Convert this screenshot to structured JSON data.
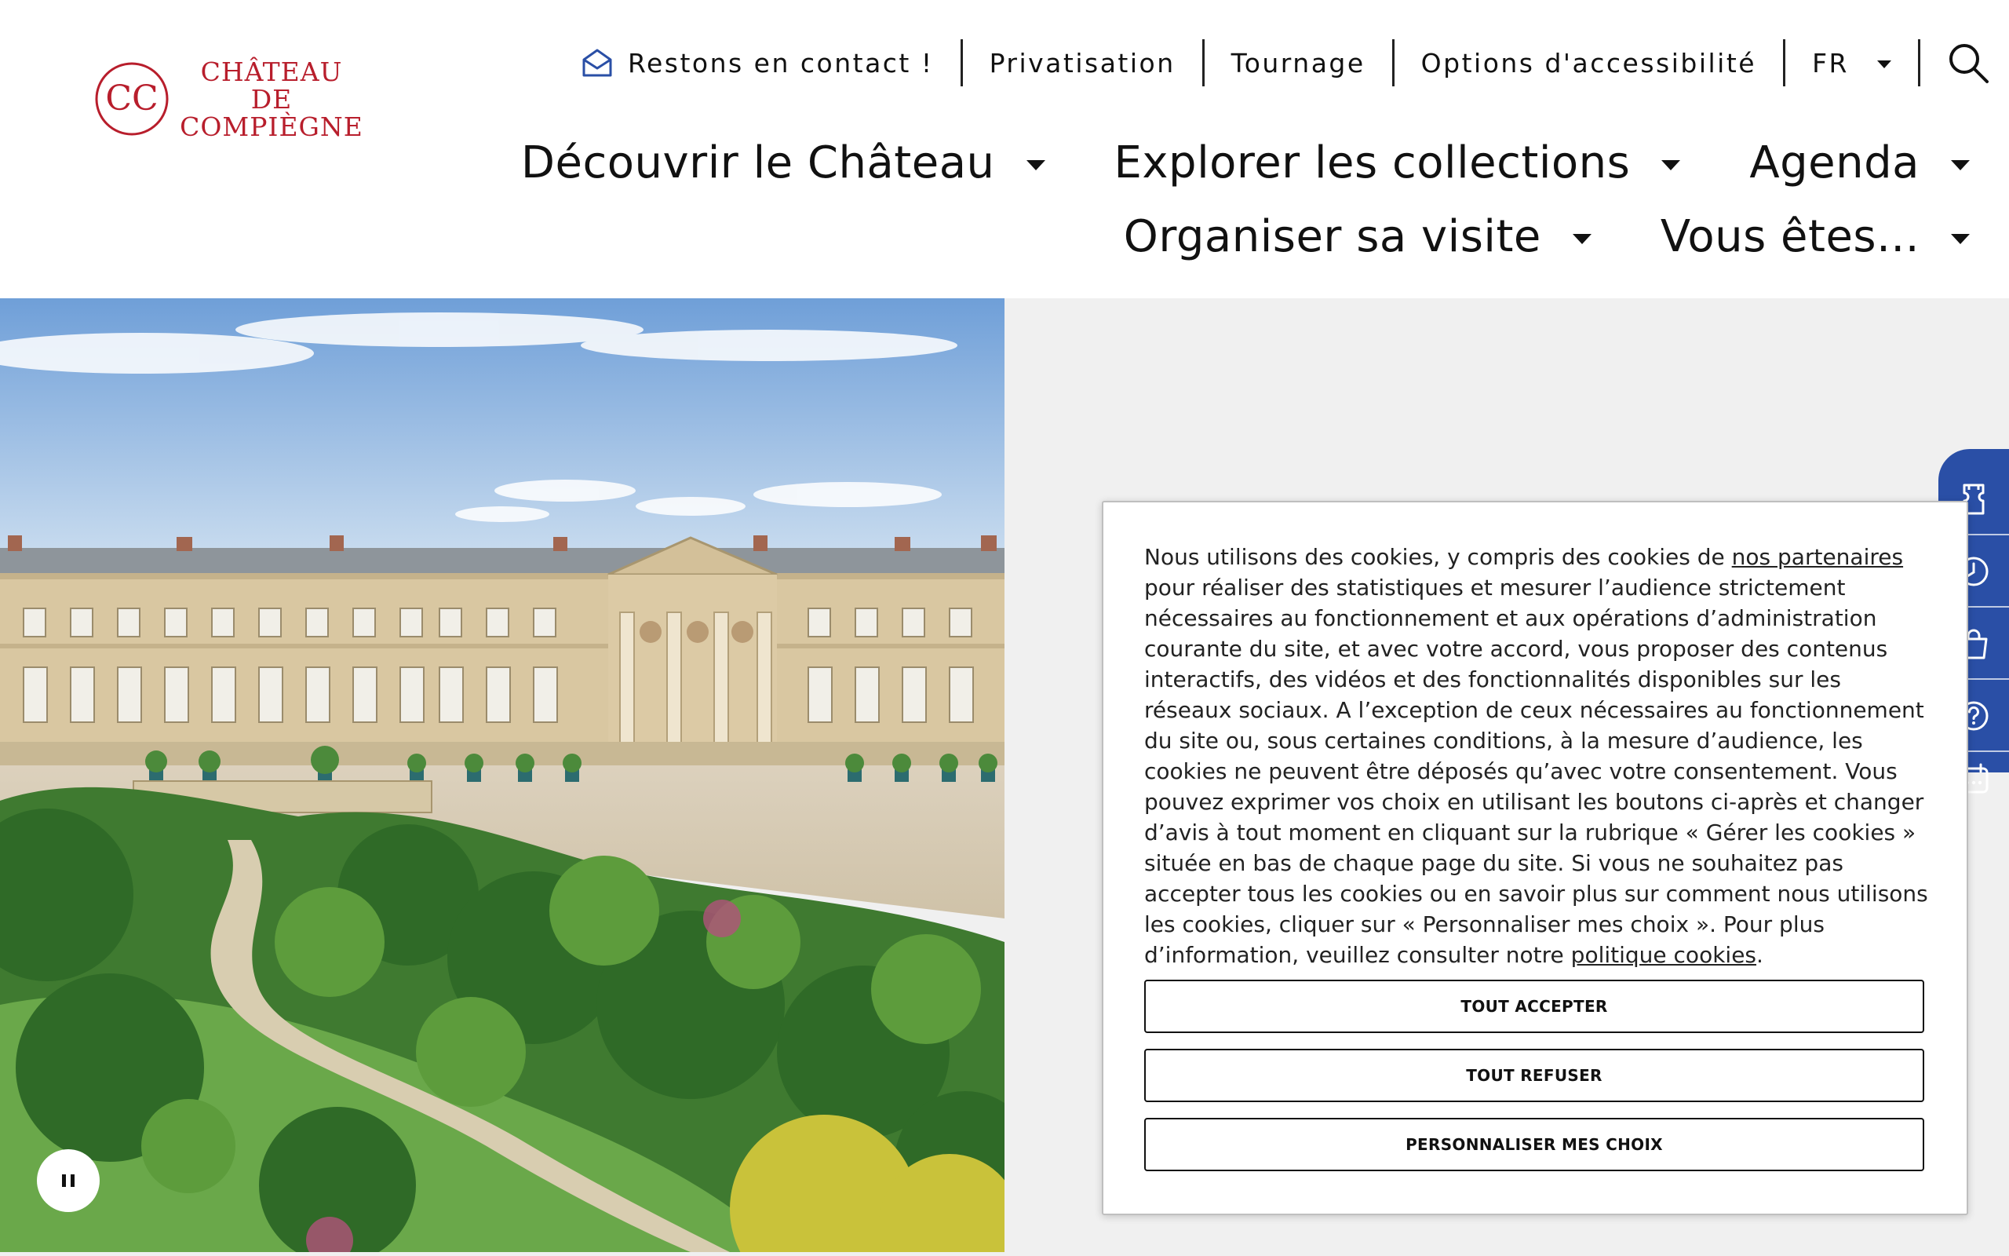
{
  "logo": {
    "monogram": "CC",
    "line1": "CHÂTEAU",
    "line2": "DE",
    "line3": "COMPIÈGNE",
    "color": "#b81e2c"
  },
  "topnav": {
    "contact": {
      "label": "Restons en contact !",
      "icon": "envelope-open-icon"
    },
    "privatisation": "Privatisation",
    "tournage": "Tournage",
    "accessibility": "Options d'accessibilité",
    "language": "FR",
    "search_icon": "search-icon"
  },
  "mainnav": {
    "discover": "Découvrir le Château",
    "collections": "Explorer les collections",
    "agenda": "Agenda",
    "visit": "Organiser sa visite",
    "you_are": "Vous êtes..."
  },
  "sidebar": {
    "accent": "#2a4fa6",
    "icons": [
      "ticket-icon",
      "clock-icon",
      "shopping-bag-icon",
      "help-icon",
      "calendar-icon"
    ]
  },
  "hero": {
    "pause_icon": "pause-icon"
  },
  "cookie": {
    "t1": "Nous utilisons des cookies, y compris des cookies de ",
    "link_partners": "nos partenaires",
    "t2": " pour réaliser des statistiques et mesurer l’audience strictement nécessaires au fonctionnement et aux opérations d’administration courante du site, et avec votre accord, vous proposer des contenus interactifs, des vidéos et des fonctionnalités disponibles sur les réseaux sociaux. A l’exception de ceux nécessaires au fonctionnement du site ou, sous certaines conditions, à la mesure d’audience, les cookies ne peuvent être déposés qu’avec votre consentement. Vous pouvez exprimer vos choix en utilisant les boutons ci-après et changer d’avis à tout moment en cliquant sur la rubrique « Gérer les cookies » située en bas de chaque page du site. Si vous ne souhaitez pas accepter tous les cookies ou en savoir plus sur comment nous utilisons les cookies, cliquer sur « Personnaliser mes choix ». Pour plus d’information, veuillez consulter notre ",
    "link_policy": "politique cookies",
    "t3": ".",
    "accept": "TOUT ACCEPTER",
    "refuse": "TOUT REFUSER",
    "customize": "PERSONNALISER MES CHOIX"
  }
}
